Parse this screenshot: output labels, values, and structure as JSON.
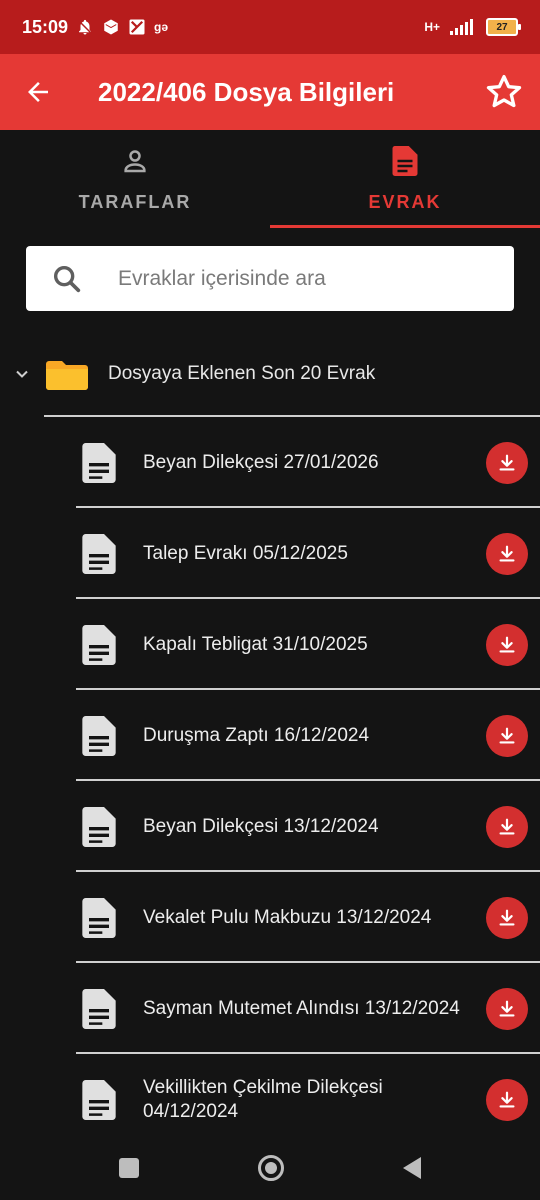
{
  "status_bar": {
    "time": "15:09",
    "network": "H+",
    "battery": "27",
    "extra_label": "gə"
  },
  "app_bar": {
    "title": "2022/406 Dosya Bilgileri",
    "back_icon": "arrow-left-icon",
    "favorite_icon": "star-outline-icon"
  },
  "tabs": [
    {
      "label": "TARAFLAR",
      "icon": "person-icon",
      "active": false
    },
    {
      "label": "EVRAK",
      "icon": "document-icon",
      "active": true
    }
  ],
  "search": {
    "placeholder": "Evraklar içerisinde ara",
    "value": ""
  },
  "folder": {
    "label": "Dosyaya Eklenen Son 20 Evrak",
    "expanded": true
  },
  "documents": [
    {
      "label": "Beyan Dilekçesi 27/01/2026"
    },
    {
      "label": "Talep Evrakı 05/12/2025"
    },
    {
      "label": "Kapalı Tebligat 31/10/2025"
    },
    {
      "label": "Duruşma Zaptı 16/12/2024"
    },
    {
      "label": "Beyan Dilekçesi 13/12/2024"
    },
    {
      "label": "Vekalet Pulu Makbuzu 13/12/2024"
    },
    {
      "label": "Sayman Mutemet Alındısı 13/12/2024"
    },
    {
      "label": "Vekillikten Çekilme Dilekçesi 04/12/2024"
    }
  ],
  "colors": {
    "status_bar": "#b71c1c",
    "app_bar": "#e53935",
    "accent": "#e53935",
    "background": "#141414",
    "folder": "#f9a825",
    "download_button": "#d32f2f"
  }
}
